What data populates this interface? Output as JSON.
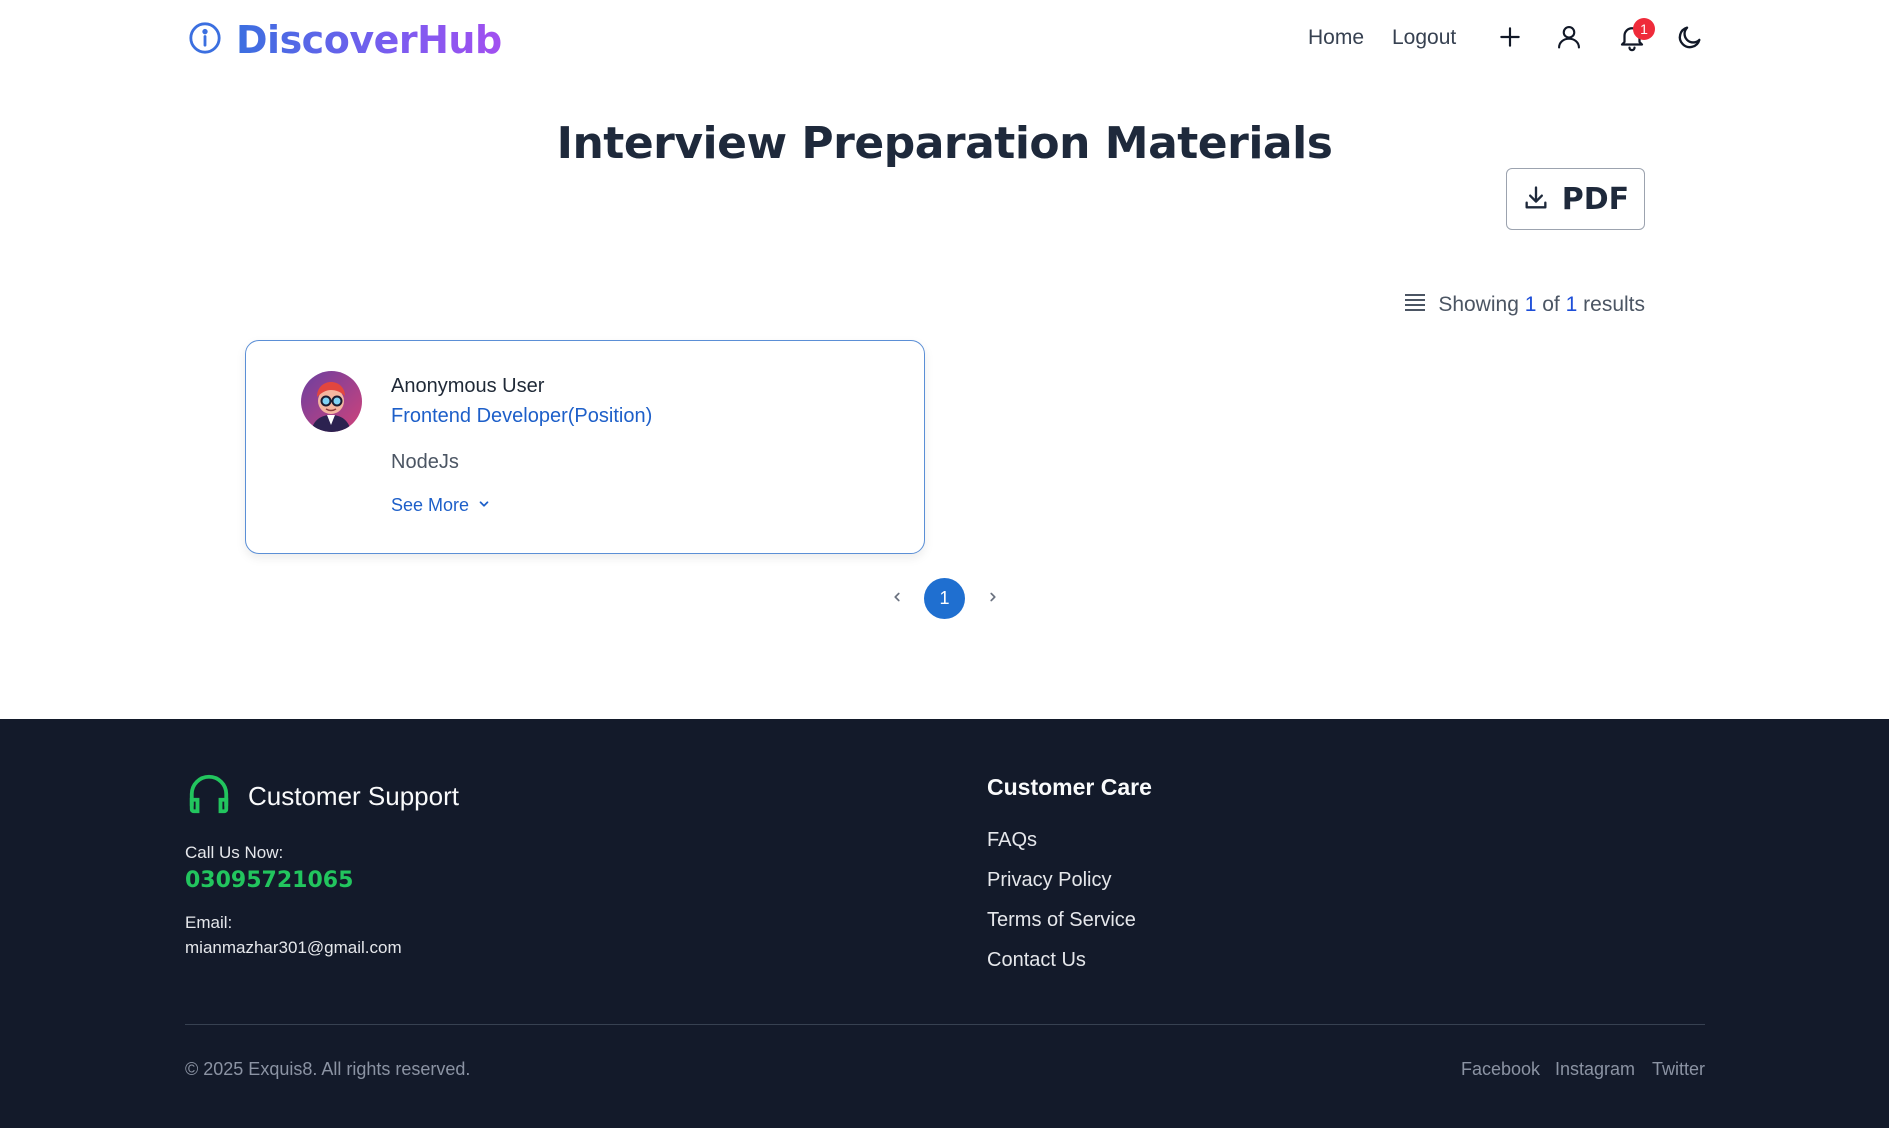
{
  "brand": {
    "name": "DiscoverHub",
    "icon": "info-circle-icon"
  },
  "nav": {
    "home": "Home",
    "logout": "Logout",
    "add_icon": "plus-icon",
    "profile_icon": "user-icon",
    "notifications_icon": "bell-icon",
    "notifications_count": "1",
    "theme_icon": "moon-icon"
  },
  "main": {
    "title": "Interview Preparation Materials",
    "pdf_button": "PDF",
    "results": {
      "prefix": "Showing",
      "current": "1",
      "of": "of",
      "total": "1",
      "suffix": "results"
    },
    "cards": [
      {
        "author": "Anonymous User",
        "position": "Frontend Developer(Position)",
        "topic": "NodeJs",
        "see_more": "See More"
      }
    ],
    "pagination": {
      "current_page": "1"
    }
  },
  "footer": {
    "support": {
      "title": "Customer Support",
      "call_label": "Call Us Now:",
      "phone": "03095721065",
      "email_label": "Email:",
      "email": "mianmazhar301@gmail.com"
    },
    "care": {
      "title": "Customer Care",
      "links": [
        "FAQs",
        "Privacy Policy",
        "Terms of Service",
        "Contact Us"
      ]
    },
    "copyright": "© 2025 Exquis8. All rights reserved.",
    "social": [
      "Facebook",
      "Instagram",
      "Twitter"
    ]
  },
  "colors": {
    "accent": "#1f6fd0",
    "footer_bg": "#131a2a",
    "support_green": "#22c55e",
    "badge_red": "#ef2b3a"
  }
}
